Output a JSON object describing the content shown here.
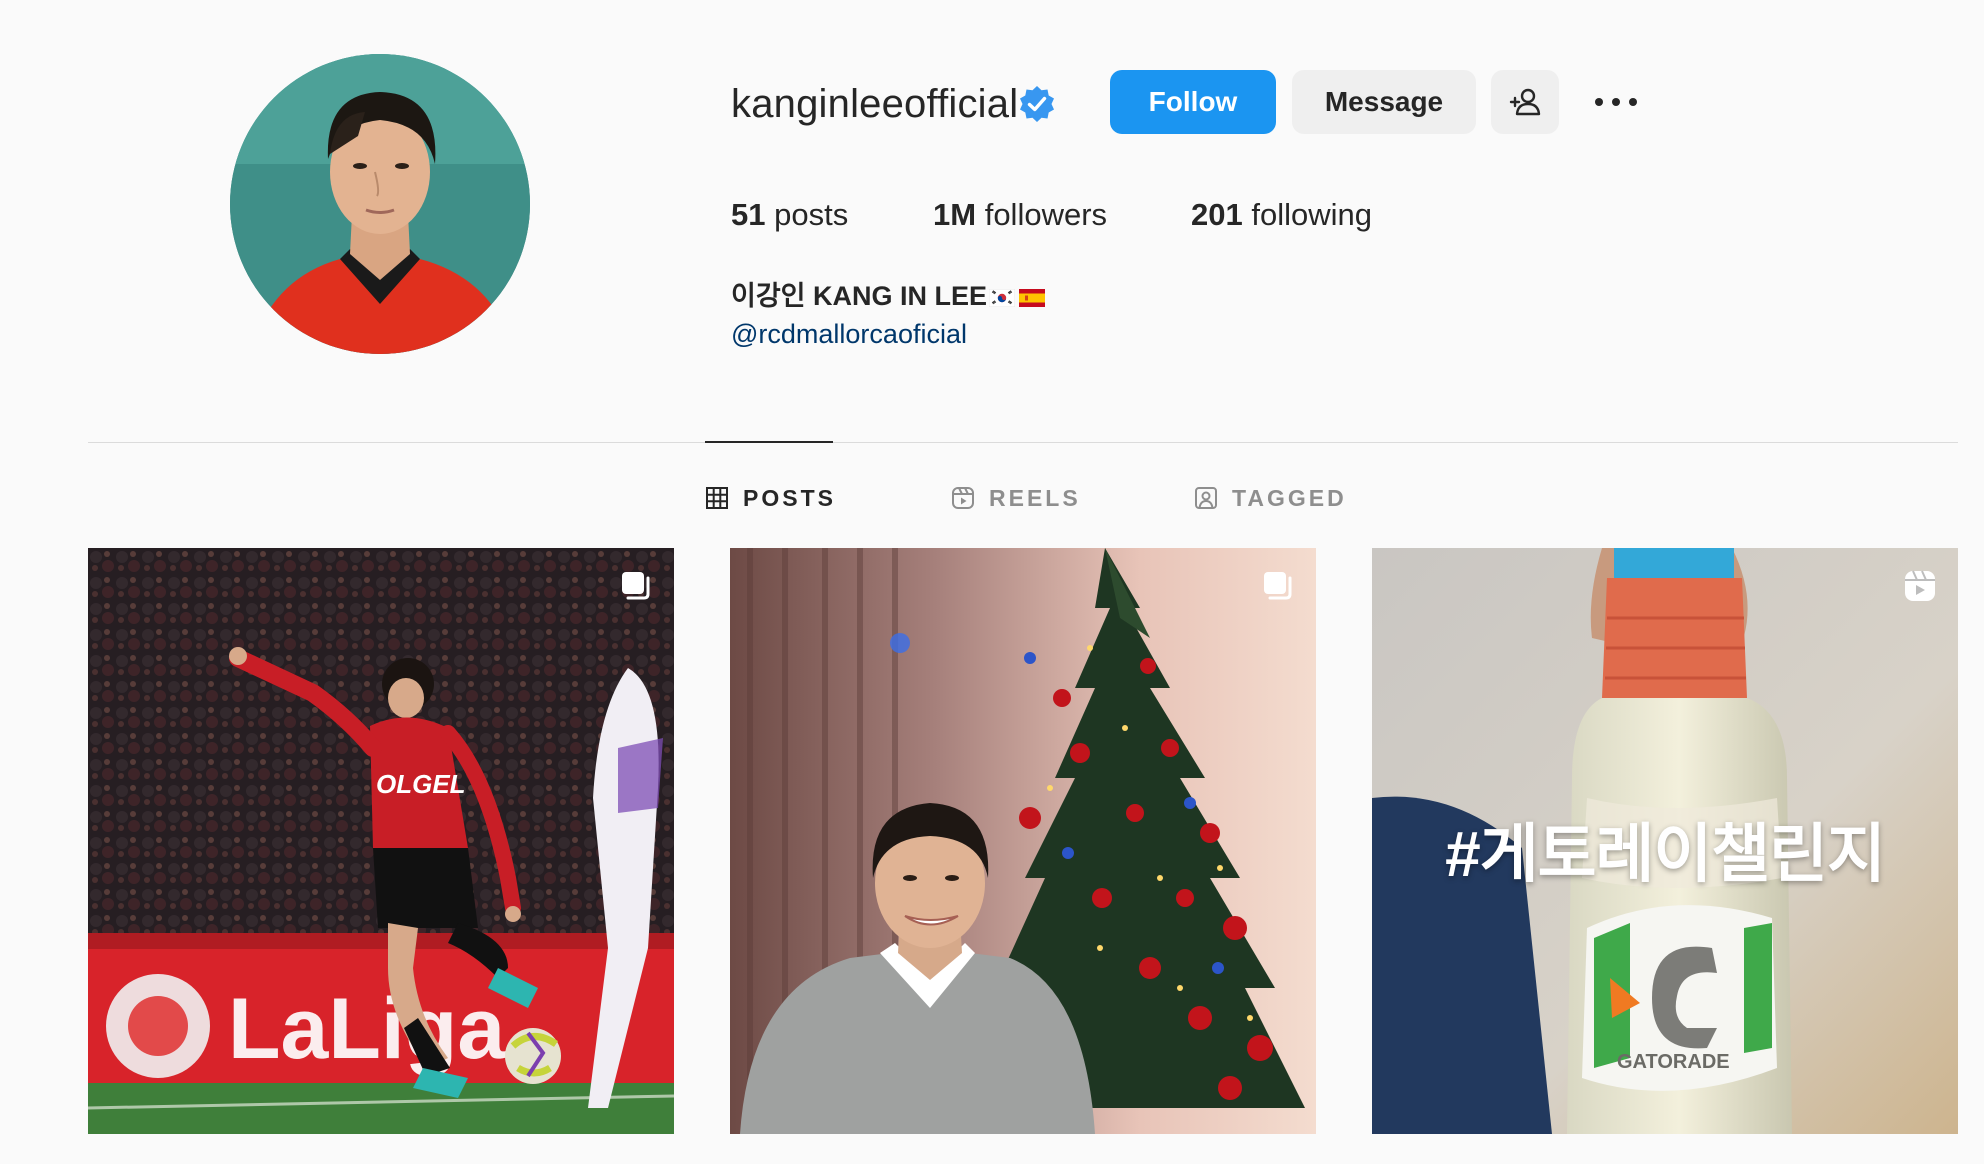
{
  "profile": {
    "username": "kanginleeofficial",
    "verified": true,
    "verified_icon": "verified-badge-icon",
    "avatar_icon": "profile-photo",
    "buttons": {
      "follow": "Follow",
      "message": "Message",
      "suggest_icon": "add-person-icon",
      "more_icon": "more-horizontal-icon"
    },
    "stats": {
      "posts_count": "51",
      "posts_label": "posts",
      "followers_count": "1M",
      "followers_label": "followers",
      "following_count": "201",
      "following_label": "following"
    },
    "bio": {
      "name": "이강인 KANG IN LEE",
      "flags": [
        "south-korea-flag-icon",
        "spain-flag-icon"
      ],
      "link": "@rcdmallorcaoficial"
    }
  },
  "tabs": [
    {
      "label": "POSTS",
      "icon": "grid-icon",
      "active": true
    },
    {
      "label": "REELS",
      "icon": "reels-icon",
      "active": false
    },
    {
      "label": "TAGGED",
      "icon": "tagged-icon",
      "active": false
    }
  ],
  "posts": [
    {
      "type_icon": "carousel-icon",
      "image": "footballer-kicking-ball-photo"
    },
    {
      "type_icon": "carousel-icon",
      "image": "man-beside-christmas-tree-photo"
    },
    {
      "type_icon": "reel-icon",
      "image": "gatorade-bottle-photo",
      "overlay_text": "#게토레이챌린지"
    }
  ],
  "colors": {
    "follow_button": "#1b95f1",
    "secondary_button": "#efefef",
    "link": "#00376b",
    "verified": "#3897f0",
    "muted": "#8e8e8e"
  }
}
